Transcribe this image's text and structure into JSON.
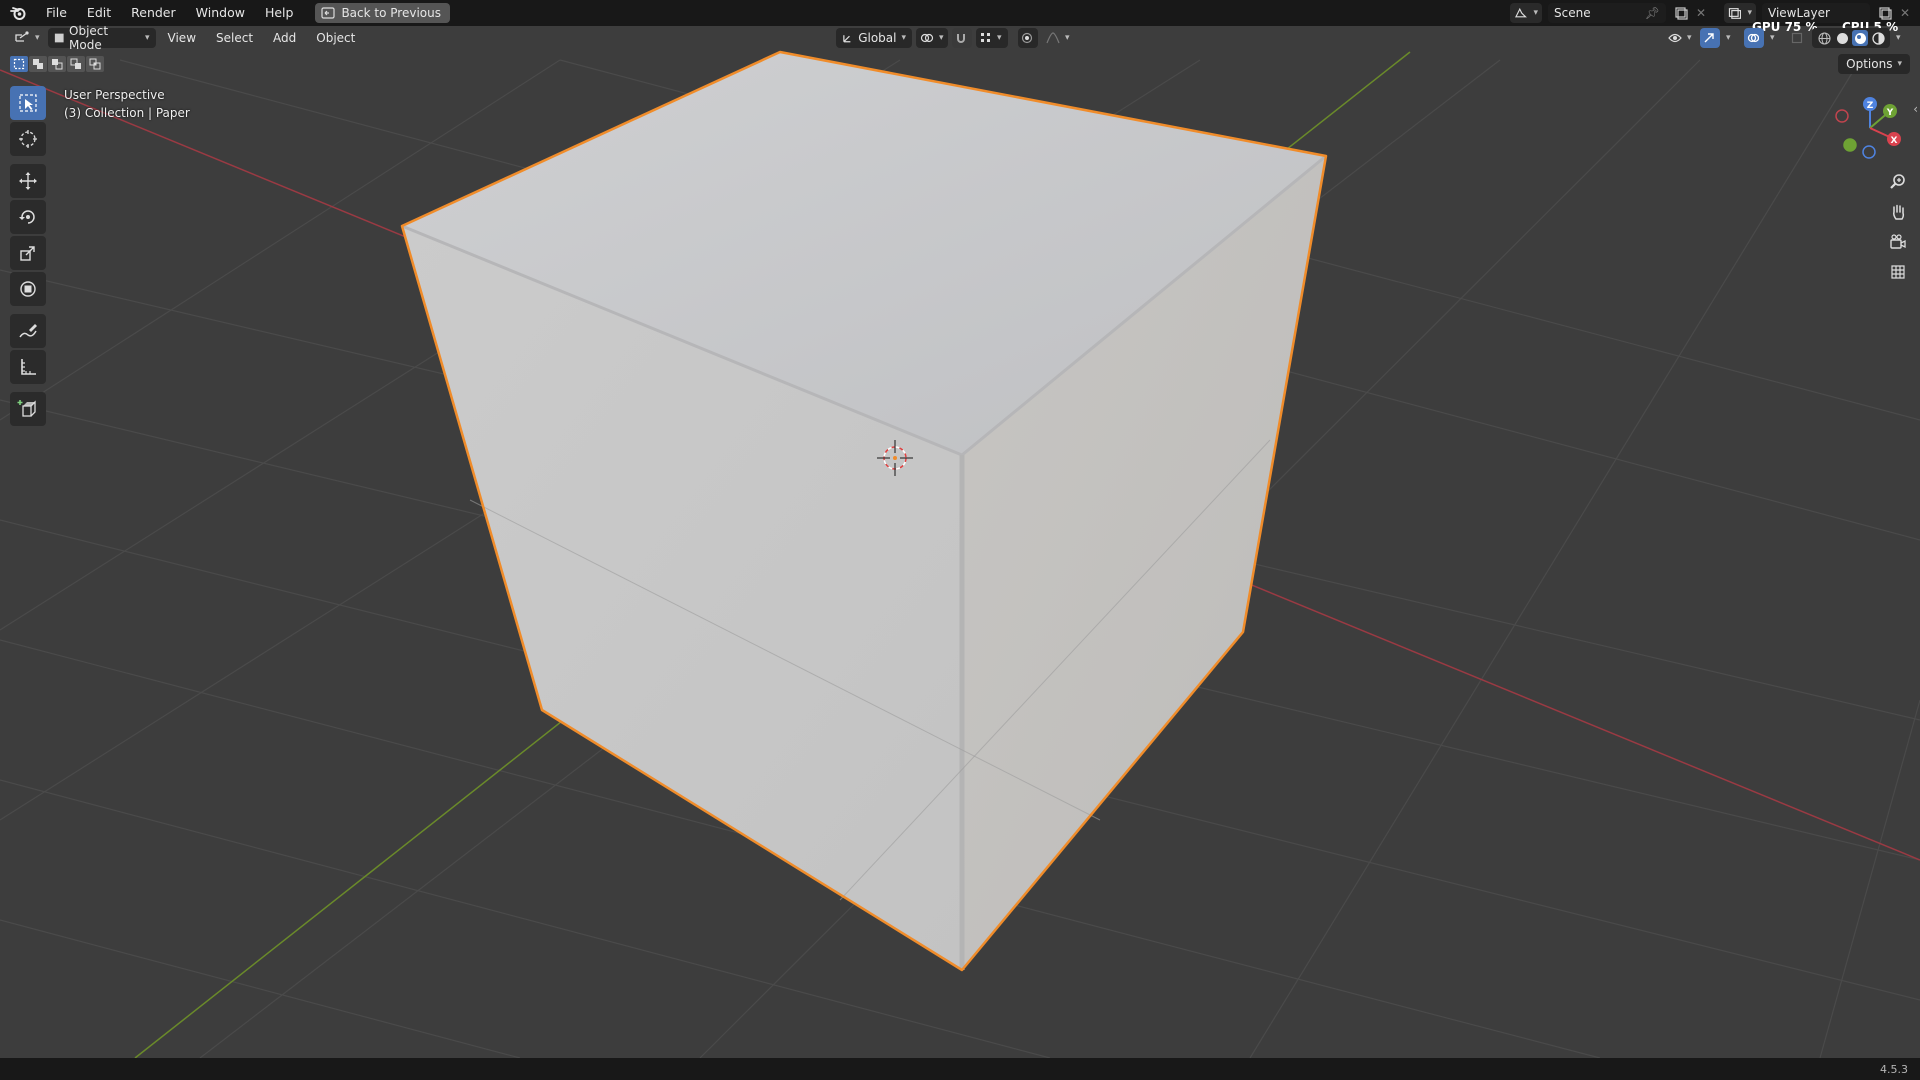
{
  "menubar": {
    "items": [
      "File",
      "Edit",
      "Render",
      "Window",
      "Help"
    ],
    "back_button": "Back to Previous",
    "scene": "Scene",
    "view_layer": "ViewLayer",
    "gpu_label": "GPU",
    "gpu_value": "75 %",
    "cpu_label": "CPU",
    "cpu_value": "5 %"
  },
  "viewport_header": {
    "mode": "Object Mode",
    "menus": [
      "View",
      "Select",
      "Add",
      "Object"
    ],
    "transform_orientation": "Global",
    "options": "Options"
  },
  "viewport_info": {
    "perspective": "User Perspective",
    "collection": "(3) Collection | Paper"
  },
  "status": {
    "version": "4.5.3"
  },
  "colors": {
    "background": "#3d3d3d",
    "grid": "#4b4b4b",
    "x_axis": "#9a3a43",
    "y_axis": "#6a8a2a",
    "selection_outline": "#f08c2a",
    "cube_face": "#c6c6c6",
    "active_tool": "#4772b3"
  },
  "gizmo": {
    "z": "Z",
    "y": "Y",
    "x": "X"
  }
}
